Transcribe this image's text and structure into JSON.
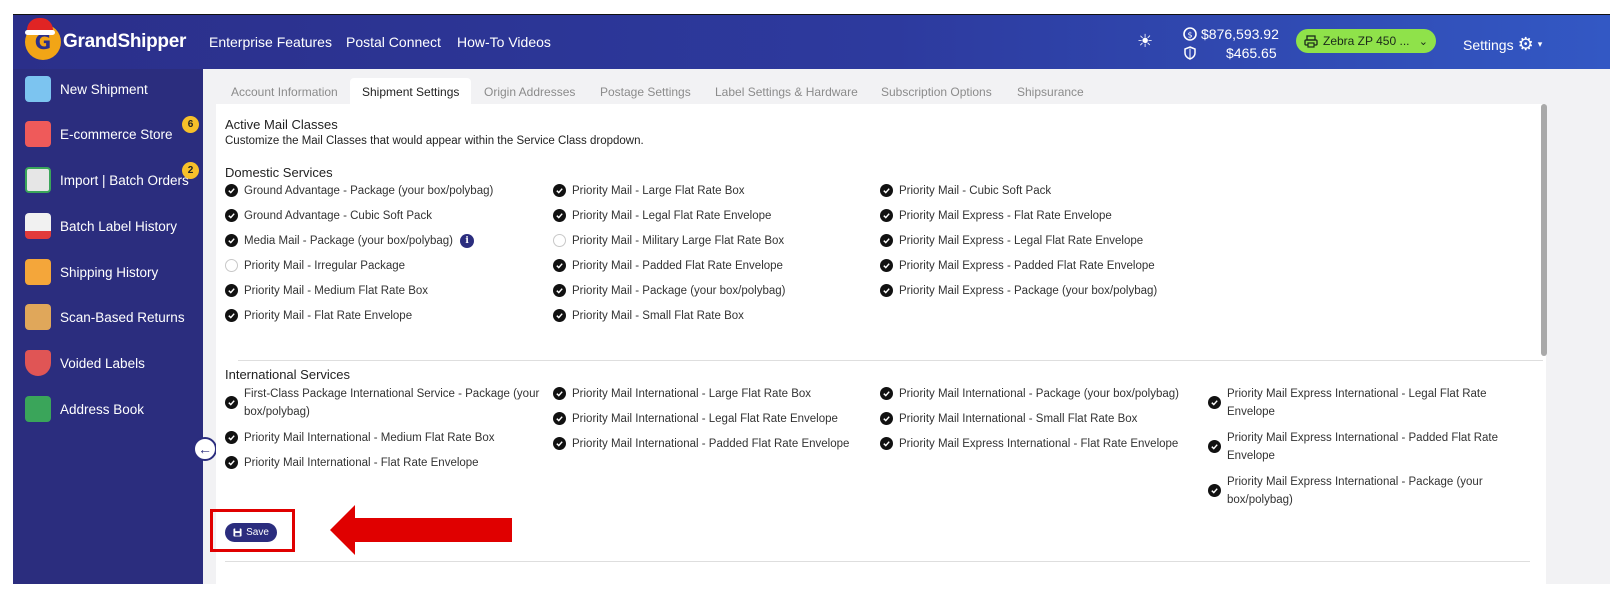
{
  "header": {
    "brand": "GrandShipper",
    "nav": [
      "Enterprise Features",
      "Postal Connect",
      "How-To Videos"
    ],
    "balance_primary": "$876,593.92",
    "balance_secondary": "$465.65",
    "printer": "Zebra ZP 450 ...",
    "settings_label": "Settings"
  },
  "sidebar": {
    "items": [
      {
        "label": "New Shipment",
        "icon": "truck-icon",
        "badge": ""
      },
      {
        "label": "E-commerce Store",
        "icon": "store-icon",
        "badge": "6"
      },
      {
        "label": "Import | Batch Orders",
        "icon": "csv-file-icon",
        "badge": "2"
      },
      {
        "label": "Batch Label History",
        "icon": "pdf-file-icon",
        "badge": ""
      },
      {
        "label": "Shipping History",
        "icon": "delivery-person-icon",
        "badge": ""
      },
      {
        "label": "Scan-Based Returns",
        "icon": "return-box-icon",
        "badge": ""
      },
      {
        "label": "Voided Labels",
        "icon": "shield-label-icon",
        "badge": ""
      },
      {
        "label": "Address Book",
        "icon": "contact-book-icon",
        "badge": ""
      }
    ]
  },
  "tabs": [
    "Account Information",
    "Shipment Settings",
    "Origin Addresses",
    "Postage Settings",
    "Label Settings & Hardware",
    "Subscription Options",
    "Shipsurance"
  ],
  "active_tab": "Shipment Settings",
  "active_mail_classes": {
    "title": "Active Mail Classes",
    "description": "Customize the Mail Classes that would appear within the Service Class dropdown."
  },
  "domestic": {
    "title": "Domestic Services",
    "columns": [
      [
        {
          "label": "Ground Advantage - Package (your box/polybag)",
          "checked": true
        },
        {
          "label": "Ground Advantage - Cubic Soft Pack",
          "checked": true
        },
        {
          "label": "Media Mail - Package (your box/polybag)",
          "checked": true,
          "info": "i"
        },
        {
          "label": "Priority Mail - Irregular Package",
          "checked": false
        },
        {
          "label": "Priority Mail - Medium Flat Rate Box",
          "checked": true
        },
        {
          "label": "Priority Mail - Flat Rate Envelope",
          "checked": true
        }
      ],
      [
        {
          "label": "Priority Mail - Large Flat Rate Box",
          "checked": true
        },
        {
          "label": "Priority Mail - Legal Flat Rate Envelope",
          "checked": true
        },
        {
          "label": "Priority Mail - Military Large Flat Rate Box",
          "checked": false
        },
        {
          "label": "Priority Mail - Padded Flat Rate Envelope",
          "checked": true
        },
        {
          "label": "Priority Mail - Package (your box/polybag)",
          "checked": true
        },
        {
          "label": "Priority Mail - Small Flat Rate Box",
          "checked": true
        }
      ],
      [
        {
          "label": "Priority Mail - Cubic Soft Pack",
          "checked": true
        },
        {
          "label": "Priority Mail Express - Flat Rate Envelope",
          "checked": true
        },
        {
          "label": "Priority Mail Express - Legal Flat Rate Envelope",
          "checked": true
        },
        {
          "label": "Priority Mail Express - Padded Flat Rate Envelope",
          "checked": true
        },
        {
          "label": "Priority Mail Express - Package (your box/polybag)",
          "checked": true
        }
      ]
    ]
  },
  "international": {
    "title": "International Services",
    "columns": [
      [
        {
          "label": "First-Class Package International Service - Package (your box/polybag)",
          "checked": true
        },
        {
          "label": "Priority Mail International - Medium Flat Rate Box",
          "checked": true
        },
        {
          "label": "Priority Mail International - Flat Rate Envelope",
          "checked": true
        }
      ],
      [
        {
          "label": "Priority Mail International - Large Flat Rate Box",
          "checked": true
        },
        {
          "label": "Priority Mail International - Legal Flat Rate Envelope",
          "checked": true
        },
        {
          "label": "Priority Mail International - Padded Flat Rate Envelope",
          "checked": true
        }
      ],
      [
        {
          "label": "Priority Mail International - Package (your box/polybag)",
          "checked": true
        },
        {
          "label": "Priority Mail International - Small Flat Rate Box",
          "checked": true
        },
        {
          "label": "Priority Mail Express International - Flat Rate Envelope",
          "checked": true
        }
      ],
      [
        {
          "label": "Priority Mail Express International - Legal Flat Rate Envelope",
          "checked": true
        },
        {
          "label": "Priority Mail Express International - Padded Flat Rate Envelope",
          "checked": true
        },
        {
          "label": "Priority Mail Express International - Package (your box/polybag)",
          "checked": true
        }
      ]
    ]
  },
  "save_label": "Save",
  "colors": {
    "primary": "#2b2d7e",
    "accent_green": "#8fe24a",
    "highlight_red": "#e00000",
    "badge_yellow": "#f7c02a"
  }
}
